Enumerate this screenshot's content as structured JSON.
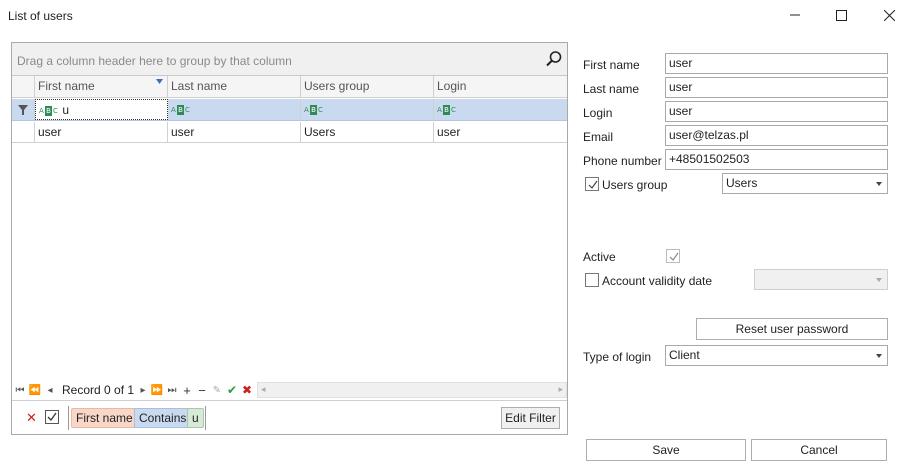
{
  "window": {
    "title": "List of users",
    "minimize_icon": "minimize-icon",
    "maximize_icon": "maximize-icon",
    "close_icon": "close-icon"
  },
  "grid": {
    "group_hint": "Drag a column header here to group by that column",
    "search_icon": "search-icon",
    "columns": [
      "First name",
      "Last name",
      "Users group",
      "Login"
    ],
    "filter_row": {
      "first_name": "u",
      "operator_icon": "abc-contains-icon"
    },
    "rows": [
      {
        "first_name": "user",
        "last_name": "user",
        "users_group": "Users",
        "login": "user"
      }
    ],
    "navigator": {
      "record_text": "Record 0 of 1"
    },
    "filter_panel": {
      "field": "First name",
      "operator": "Contains",
      "value": "u",
      "edit_button": "Edit Filter"
    }
  },
  "form": {
    "first_name_label": "First name",
    "first_name_value": "user",
    "last_name_label": "Last name",
    "last_name_value": "user",
    "login_label": "Login",
    "login_value": "user",
    "email_label": "Email",
    "email_value": "user@telzas.pl",
    "phone_label": "Phone number",
    "phone_value": "+48501502503",
    "users_group_label": "Users group",
    "users_group_checked": true,
    "users_group_value": "Users",
    "active_label": "Active",
    "active_checked": true,
    "validity_label": "Account validity date",
    "validity_checked": false,
    "validity_value": "",
    "reset_password_button": "Reset user password",
    "type_of_login_label": "Type of login",
    "type_of_login_value": "Client"
  },
  "footer": {
    "save_button": "Save",
    "cancel_button": "Cancel"
  }
}
